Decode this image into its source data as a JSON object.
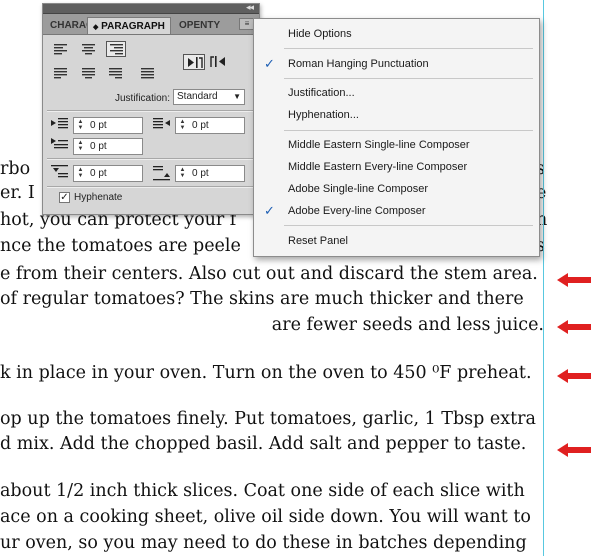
{
  "document": {
    "lines": [
      "rbo",
      "er. I",
      " hot, you can protect your f",
      "nce the tomatoes are peele",
      "e from their centers. Also cut out and discard the stem area.",
      " of regular tomatoes? The skins are much thicker and there",
      "are fewer seeds and less juice.",
      "k in place in your oven. Turn on the oven to  450 ⁰F preheat.",
      "op up the tomatoes finely. Put tomatoes, garlic, 1 Tbsp extra",
      "d mix. Add the chopped basil. Add salt and pepper to taste.",
      "about 1/2 inch thick slices. Coat one side of each slice with",
      "ace on a cooking sheet, olive oil side down. You will want to",
      "ur oven, so you may need to do these in batches depending"
    ],
    "right_edge_fragments": [
      "s",
      "e",
      "n",
      "s"
    ],
    "arrow_color": "#e02020"
  },
  "panel": {
    "tabs": [
      "CHARAC",
      "PARAGRAPH",
      "OPENTY"
    ],
    "active_tab": "PARAGRAPH",
    "tab_arrows": "◆",
    "menu_button_glyph": "≡",
    "justification_label": "Justification:",
    "justification_value": "Standard",
    "indent_left": "0 pt",
    "indent_right": "0 pt",
    "first_line_indent": "0 pt",
    "space_before": "0 pt",
    "space_after": "0 pt",
    "hyphenate_label": "Hyphenate",
    "hyphenate_checked": true
  },
  "menu": {
    "items": {
      "hide_options": "Hide Options",
      "roman_hanging": "Roman Hanging Punctuation",
      "justification": "Justification...",
      "hyphenation": "Hyphenation...",
      "me_single": "Middle Eastern Single-line Composer",
      "me_every": "Middle Eastern Every-line Composer",
      "adobe_single": "Adobe Single-line Composer",
      "adobe_every": "Adobe Every-line Composer",
      "reset": "Reset Panel"
    },
    "check_glyph": "✓",
    "checked": [
      "Roman Hanging Punctuation",
      "Adobe Every-line Composer"
    ],
    "accent_color": "#1e5fb4"
  }
}
